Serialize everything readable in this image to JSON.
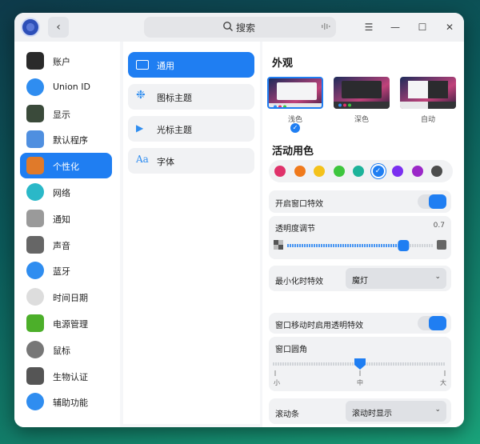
{
  "window": {
    "search_placeholder": "搜索"
  },
  "sidebar": {
    "items": [
      {
        "label": "账户",
        "icon": "account-icon",
        "color": "#2a2a2a"
      },
      {
        "label": "Union ID",
        "icon": "cloud-icon",
        "color": "#2f8df0"
      },
      {
        "label": "显示",
        "icon": "display-icon",
        "color": "#3a4a3a"
      },
      {
        "label": "默认程序",
        "icon": "default-apps-icon",
        "color": "#4f8fe0"
      },
      {
        "label": "个性化",
        "icon": "personalization-icon",
        "color": "#e07a2a",
        "active": true
      },
      {
        "label": "网络",
        "icon": "network-icon",
        "color": "#2ab8c8"
      },
      {
        "label": "通知",
        "icon": "bell-icon",
        "color": "#9a9a9a"
      },
      {
        "label": "声音",
        "icon": "speaker-icon",
        "color": "#666666"
      },
      {
        "label": "蓝牙",
        "icon": "bluetooth-icon",
        "color": "#2f8df0"
      },
      {
        "label": "时间日期",
        "icon": "clock-icon",
        "color": "#dddddd"
      },
      {
        "label": "电源管理",
        "icon": "battery-icon",
        "color": "#4caf2a"
      },
      {
        "label": "鼠标",
        "icon": "mouse-icon",
        "color": "#777777"
      },
      {
        "label": "生物认证",
        "icon": "fingerprint-grid-icon",
        "color": "#555555"
      },
      {
        "label": "辅助功能",
        "icon": "accessibility-icon",
        "color": "#2f8df0"
      }
    ]
  },
  "midpane": {
    "items": [
      {
        "label": "通用",
        "icon": "window-icon",
        "active": true
      },
      {
        "label": "图标主题",
        "icon": "icon-theme-icon"
      },
      {
        "label": "光标主题",
        "icon": "cursor-icon"
      },
      {
        "label": "字体",
        "icon": "font-icon",
        "glyph": "Aa"
      }
    ]
  },
  "content": {
    "appearance_title": "外观",
    "themes": [
      {
        "label": "浅色",
        "selected": true
      },
      {
        "label": "深色"
      },
      {
        "label": "自动"
      }
    ],
    "accent_title": "活动用色",
    "accent_colors": [
      "#e0336b",
      "#f07a1c",
      "#f4c21b",
      "#3ec63e",
      "#1db39a",
      "#1f7ef2",
      "#7b2ff0",
      "#9b28c8",
      "#4d4d4d"
    ],
    "accent_selected_index": 5,
    "window_effect_label": "开启窗口特效",
    "window_effect_on": true,
    "transparency_label": "透明度调节",
    "transparency_value": "0.7",
    "minimize_label": "最小化时特效",
    "minimize_value": "魔灯",
    "move_transparent_label": "窗口移动时启用透明特效",
    "move_transparent_on": true,
    "corner_label": "窗口圆角",
    "corner_ticks": [
      "小",
      "中",
      "大"
    ],
    "corner_level": 0.5,
    "scrollbar_label": "滚动条",
    "scrollbar_value": "滚动时显示"
  }
}
